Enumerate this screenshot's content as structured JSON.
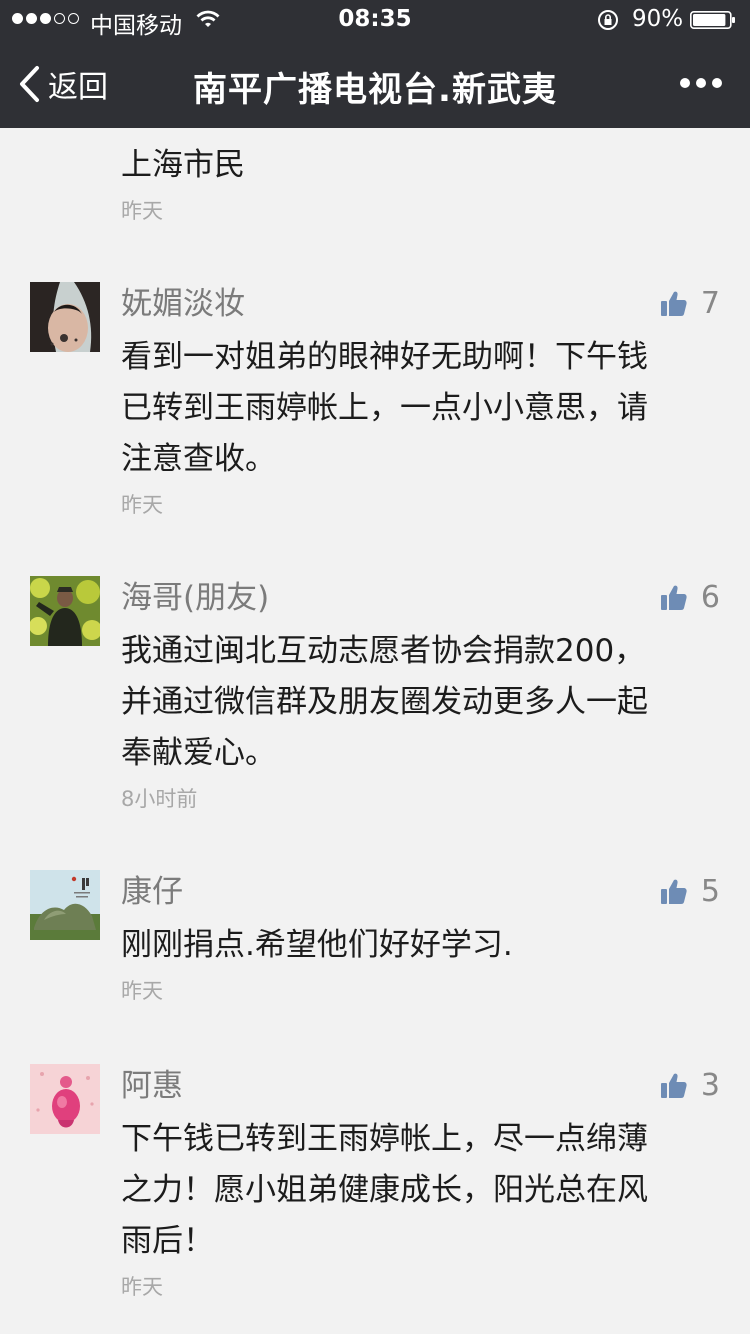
{
  "status_bar": {
    "carrier": "中国移动",
    "time": "08:35",
    "battery_percent": "90%",
    "signal_bars_filled": 3,
    "signal_bars_total": 5,
    "battery_level": 0.9
  },
  "nav": {
    "back_label": "返回",
    "title": "南平广播电视台.新武夷",
    "more_icon": "more-dots-icon"
  },
  "partial_comment": {
    "text": "上海市民",
    "time": "昨天"
  },
  "comments": [
    {
      "name": "妩媚淡妆",
      "likes": "7",
      "text_lines": [
        "看到一对姐弟的眼神好无助啊！下午钱",
        "已转到王雨婷帐上，一点小小意思，请",
        "注意查收。"
      ],
      "time": "昨天"
    },
    {
      "name": "海哥(朋友)",
      "likes": "6",
      "text_lines": [
        "我通过闽北互动志愿者协会捐款200，",
        "并通过微信群及朋友圈发动更多人一起",
        "奉献爱心。"
      ],
      "time": "8小时前"
    },
    {
      "name": "康仔",
      "likes": "5",
      "text_lines": [
        "刚刚捐点.希望他们好好学习."
      ],
      "time": "昨天"
    },
    {
      "name": "阿惠",
      "likes": "3",
      "text_lines": [
        "下午钱已转到王雨婷帐上，尽一点绵薄",
        "之力！愿小姐弟健康成长，阳光总在风",
        "雨后！"
      ],
      "time": "昨天"
    }
  ],
  "colors": {
    "header_bg": "#2f3035",
    "page_bg": "#f2f2f2",
    "name_text": "#7b7b7b",
    "body_text": "#1c1c1c",
    "time_text": "#a8a8a8",
    "like_icon": "#6e8cb5"
  }
}
